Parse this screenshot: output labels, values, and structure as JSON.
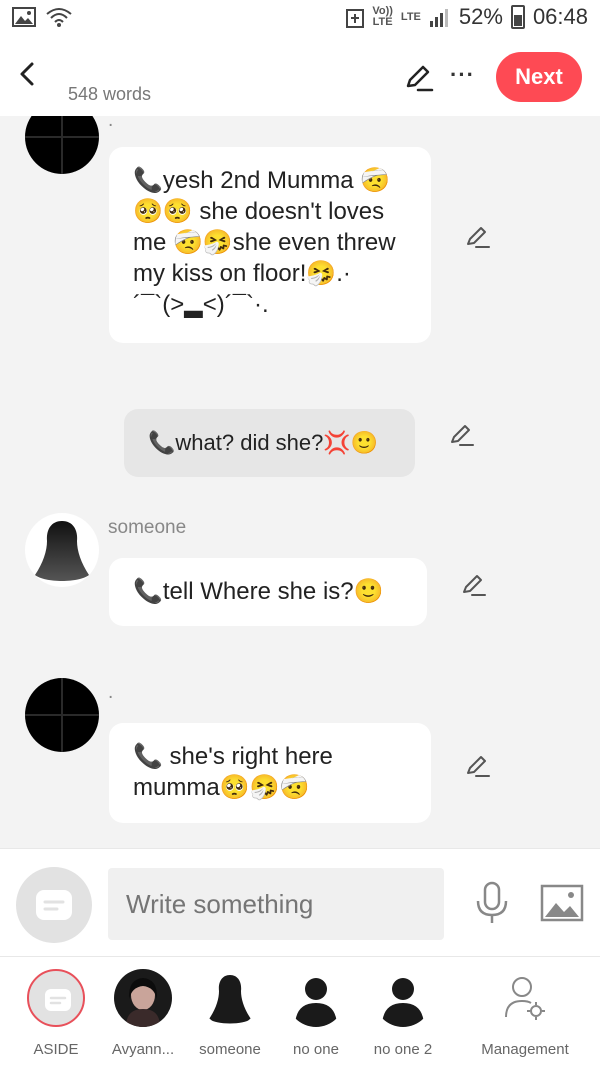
{
  "status_bar": {
    "network_small_top": "Vo))",
    "network_small_bottom": "LTE",
    "lte_label": "LTE",
    "battery": "52%",
    "time": "06:48"
  },
  "header": {
    "word_count": "548 words",
    "next_label": "Next",
    "more_label": "···"
  },
  "messages": [
    {
      "speaker": ".",
      "text": "📞yesh 2nd Mumma 🤕🥺🥺 she doesn't loves me 🤕🤧she even threw my kiss on floor!🤧.·´¯`(>▂<)´¯`·."
    },
    {
      "speaker": "",
      "text": "📞what? did she?💢🙂"
    },
    {
      "speaker": "someone",
      "text": "📞tell Where she is?🙂"
    },
    {
      "speaker": ".",
      "text": "📞 she's right here mumma🥺🤧🤕"
    }
  ],
  "input": {
    "placeholder": "Write something"
  },
  "characters": [
    {
      "label": "ASIDE"
    },
    {
      "label": "Avyann..."
    },
    {
      "label": "someone"
    },
    {
      "label": "no one"
    },
    {
      "label": "no one 2"
    },
    {
      "label": "Management"
    }
  ],
  "colors": {
    "accent": "#fe4a54",
    "chat_bg": "#f3f3f3"
  }
}
